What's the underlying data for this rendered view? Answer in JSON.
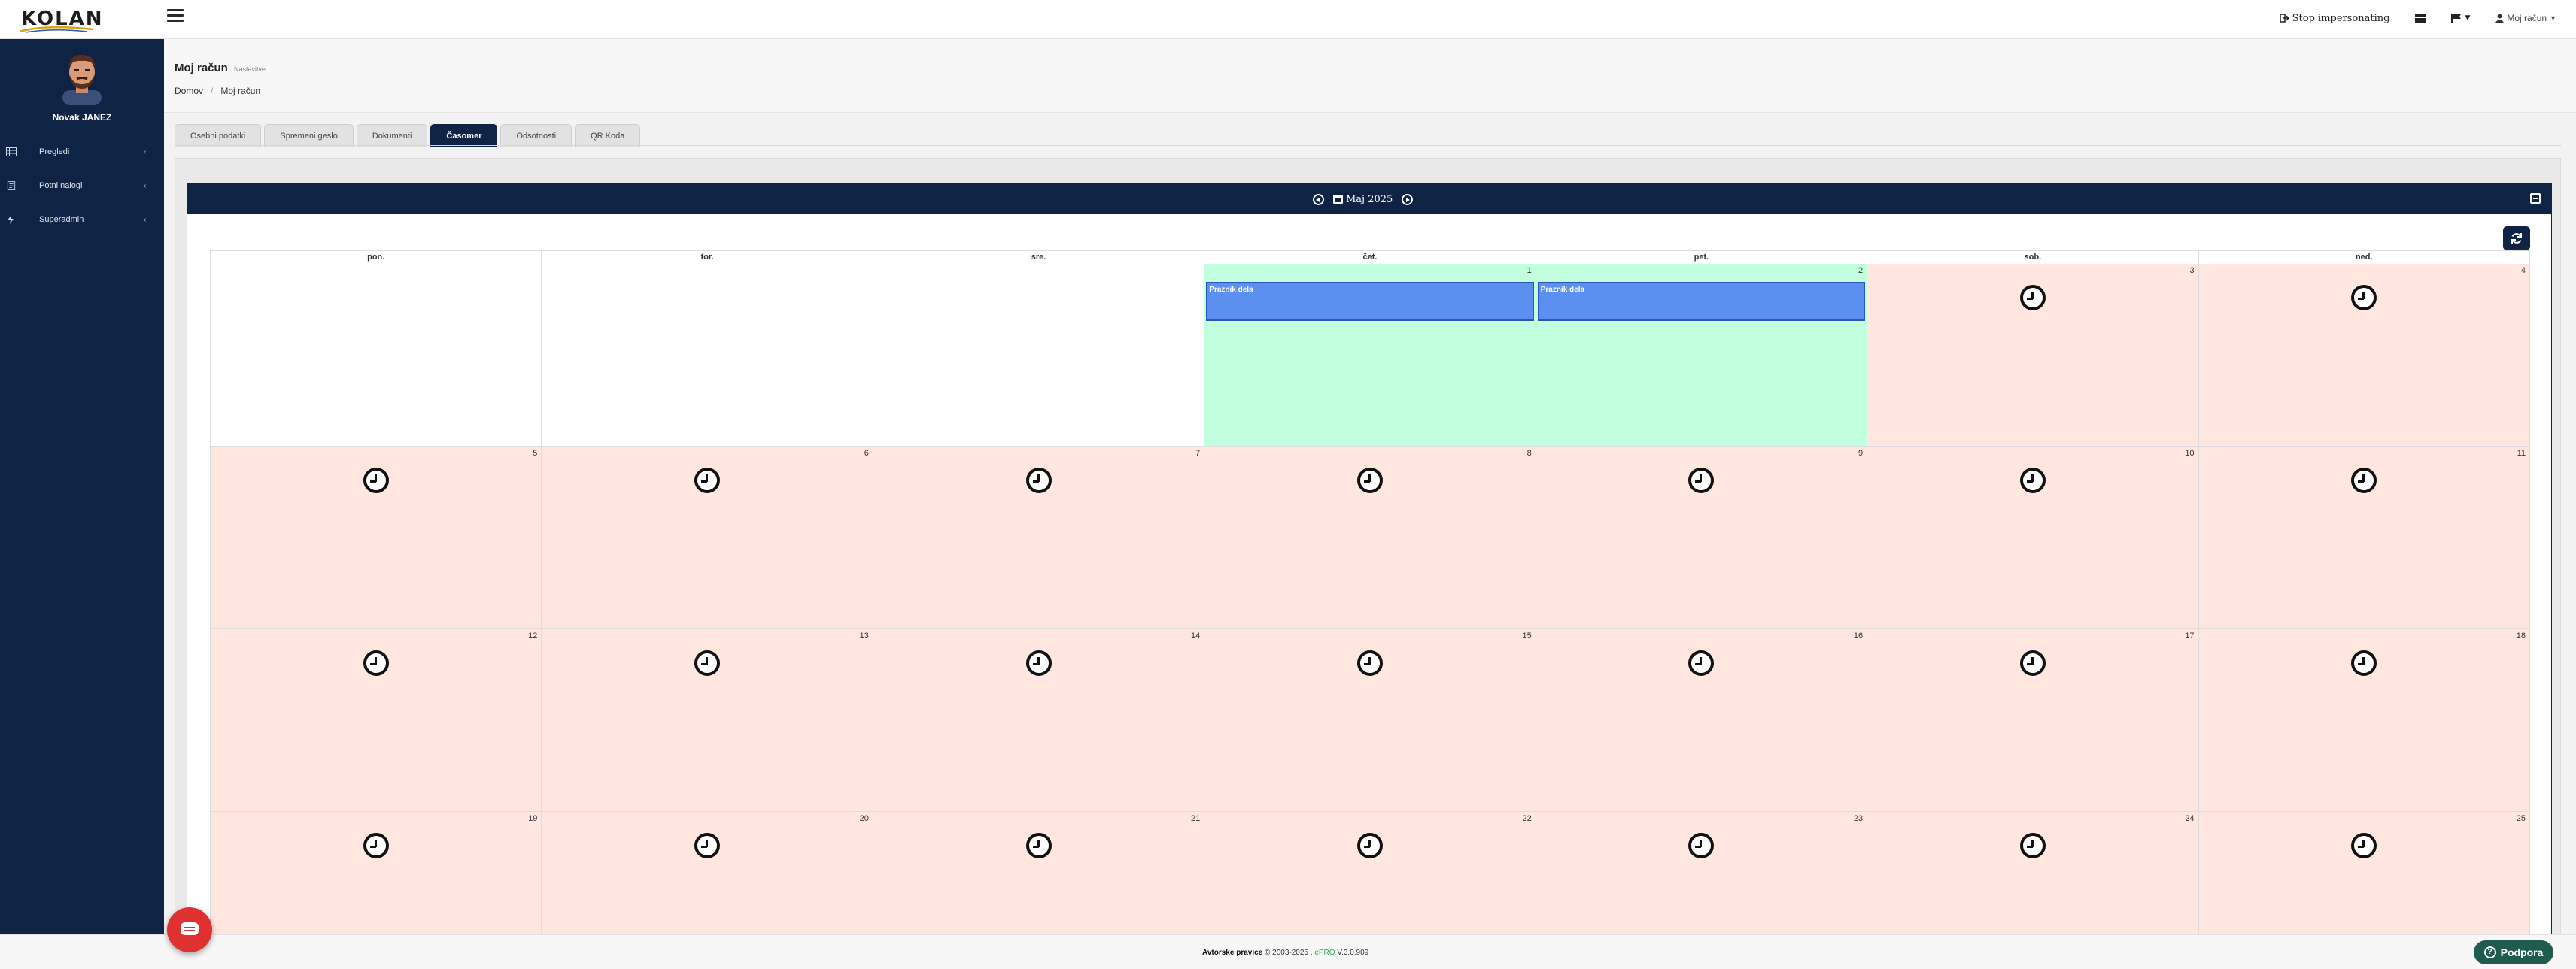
{
  "topbar": {
    "logo_text": "KOLAN",
    "stop_impersonating": "Stop impersonating",
    "account_label": "Moj račun"
  },
  "sidebar": {
    "user_name": "Novak JANEZ",
    "items": [
      {
        "label": "Pregledi",
        "icon": "grid-icon"
      },
      {
        "label": "Potni nalogi",
        "icon": "document-icon"
      },
      {
        "label": "Superadmin",
        "icon": "bolt-icon"
      }
    ]
  },
  "page": {
    "title": "Moj račun",
    "subtitle": "Nastavitve",
    "breadcrumb": [
      "Domov",
      "Moj račun"
    ]
  },
  "tabs": [
    {
      "label": "Osebni podatki",
      "active": false
    },
    {
      "label": "Spremeni geslo",
      "active": false
    },
    {
      "label": "Dokumenti",
      "active": false
    },
    {
      "label": "Časomer",
      "active": true
    },
    {
      "label": "Odsotnosti",
      "active": false
    },
    {
      "label": "QR Koda",
      "active": false
    }
  ],
  "calendar": {
    "month_label": "Maj 2025",
    "weekdays": [
      "pon.",
      "tor.",
      "sre.",
      "čet.",
      "pet.",
      "sob.",
      "ned."
    ],
    "leading_empty": 3,
    "days": [
      {
        "num": "1",
        "type": "holiday",
        "event": "Praznik dela"
      },
      {
        "num": "2",
        "type": "holiday",
        "event": "Praznik dela"
      },
      {
        "num": "3",
        "type": "normal"
      },
      {
        "num": "4",
        "type": "normal"
      },
      {
        "num": "5",
        "type": "normal"
      },
      {
        "num": "6",
        "type": "normal"
      },
      {
        "num": "7",
        "type": "normal"
      },
      {
        "num": "8",
        "type": "normal"
      },
      {
        "num": "9",
        "type": "normal"
      },
      {
        "num": "10",
        "type": "normal"
      },
      {
        "num": "11",
        "type": "normal"
      },
      {
        "num": "12",
        "type": "normal"
      },
      {
        "num": "13",
        "type": "normal"
      },
      {
        "num": "14",
        "type": "normal"
      },
      {
        "num": "15",
        "type": "normal"
      },
      {
        "num": "16",
        "type": "normal"
      },
      {
        "num": "17",
        "type": "normal"
      },
      {
        "num": "18",
        "type": "normal"
      },
      {
        "num": "19",
        "type": "normal"
      },
      {
        "num": "20",
        "type": "normal"
      },
      {
        "num": "21",
        "type": "normal"
      },
      {
        "num": "22",
        "type": "normal"
      },
      {
        "num": "23",
        "type": "normal"
      },
      {
        "num": "24",
        "type": "normal"
      },
      {
        "num": "25",
        "type": "normal"
      }
    ]
  },
  "footer": {
    "prefix": "Avtorske pravice",
    "years": "© 2003-2025 ,",
    "brand": "ePRO",
    "version": "V.3.0.909"
  },
  "support": {
    "label": "Podpora"
  },
  "colors": {
    "navy": "#0f2444",
    "weekday_cell": "#ffe7df",
    "holiday_cell": "#c2ffdf",
    "event": "#5b8ff0",
    "chat": "#e03131",
    "support": "#1f5b4e"
  }
}
